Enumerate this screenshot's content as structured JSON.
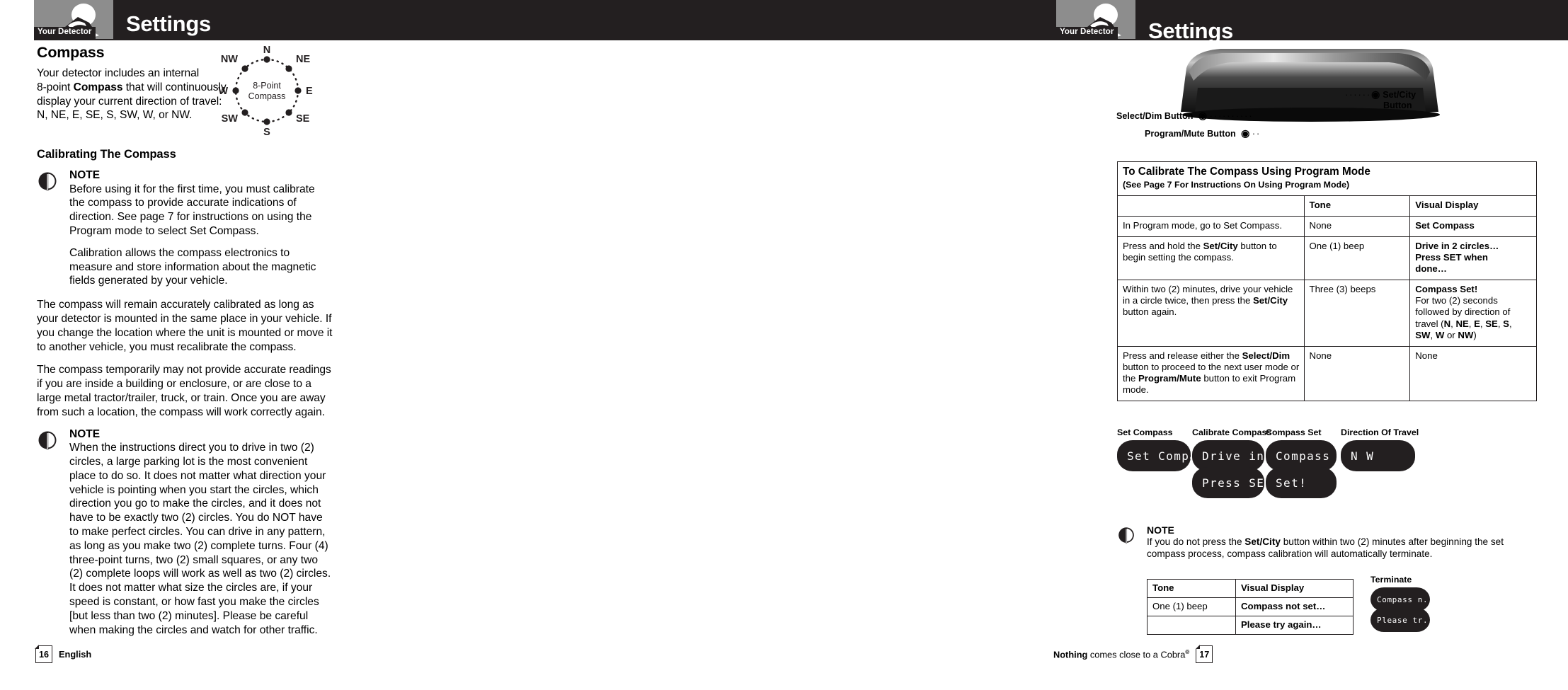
{
  "header": {
    "left": {
      "title": "Settings",
      "tag": "Your Detector"
    },
    "right": {
      "title": "Settings",
      "tag": "Your Detector"
    }
  },
  "left_page": {
    "section_title": "Compass",
    "intro": "Your detector includes an internal 8-point Compass that will continuously display your current direction of travel: N, NE, E, SE, S, SW, W, or NW.",
    "intro_bold_word": "Compass",
    "compass_diagram": {
      "center_line1": "8-Point",
      "center_line2": "Compass",
      "points": [
        "N",
        "NE",
        "E",
        "SE",
        "S",
        "SW",
        "W",
        "NW"
      ]
    },
    "subsection_title": "Calibrating The Compass",
    "note1": {
      "label": "NOTE",
      "p1": "Before using it for the first time, you must calibrate the compass to provide accurate indications of direction. See page 7 for instructions on using the Program mode to select Set Compass.",
      "p2": "Calibration allows the compass electronics to measure and store information about the magnetic fields generated by your vehicle."
    },
    "para1": "The compass will remain accurately calibrated as long as your detector is mounted in the same place in your vehicle. If you change the location where the unit is mounted or move it to another vehicle, you must recalibrate the compass.",
    "para2": "The compass temporarily may not provide accurate readings if you are inside a building or enclosure, or are close to a large metal tractor/trailer, truck, or train. Once you are away from such a location, the compass will work correctly again.",
    "note2": {
      "label": "NOTE",
      "p1": "When the instructions direct you to drive in two (2) circles, a large parking lot is the most convenient place to do so. It does not matter what direction your vehicle is pointing when you start the circles, which direction you go to make the circles, and it does not have to be exactly two (2) circles. You do NOT have to make perfect circles. You can drive in any pattern, as long as you make two (2) complete turns. Four (4) three-point turns, two (2) small squares, or any two (2) complete loops will work as well as two (2) circles. It does not matter what size the circles are, if your speed is constant, or how fast you make the circles [but less than two (2) minutes]. Please be careful when making the circles and watch for other traffic."
    },
    "footer": {
      "page": "16",
      "text": "English"
    }
  },
  "right_page": {
    "callouts": {
      "select_dim": "Select/Dim Button",
      "program_mute": "Program/Mute Button",
      "set_city_line1": "Set/City",
      "set_city_line2": "Button"
    },
    "table": {
      "title": "To Calibrate The Compass Using Program Mode",
      "subtitle": "(See Page 7 For Instructions On Using Program Mode)",
      "headers": [
        "",
        "Tone",
        "Visual Display"
      ],
      "rows": [
        {
          "step_html": "In Program mode, go to Set Compass.",
          "tone": "None",
          "visual_html": "<b>Set Compass</b>"
        },
        {
          "step_html": "Press and hold the <b>Set/City</b> button to begin setting the compass.",
          "tone": "One (1) beep",
          "visual_html": "<b>Drive in 2 circles…<br>Press SET when<br>done…</b>"
        },
        {
          "step_html": "Within two (2) minutes, drive your vehicle in a circle twice, then press the <b>Set/City</b> button again.",
          "tone": "Three (3) beeps",
          "visual_html": "<b>Compass Set!</b><br>For two (2) seconds followed by direction of travel (<b>N</b>, <b>NE</b>, <b>E</b>, <b>SE</b>, <b>S</b>, <b>SW</b>, <b>W</b> or <b>NW</b>)"
        },
        {
          "step_html": "Press and release either the <b>Select/Dim</b> button to proceed to the next user mode or the <b>Program/Mute</b> button to exit Program mode.",
          "tone": "None",
          "visual_html": "None"
        }
      ]
    },
    "lcd_displays": [
      {
        "label": "Set Compass",
        "screens": [
          "Set Compa..."
        ]
      },
      {
        "label": "Calibrate Compass",
        "screens": [
          "Drive in...",
          "Press SET..."
        ]
      },
      {
        "label": "Compass Set",
        "screens": [
          "Compass",
          "Set!"
        ]
      },
      {
        "label": "Direction Of Travel",
        "screens": [
          "N W        h"
        ]
      }
    ],
    "note": {
      "label": "NOTE",
      "text_html": "If you do not press the <b>Set/City</b> button within two (2) minutes after beginning the set compass process, compass calibration will automatically terminate."
    },
    "table2": {
      "headers": [
        "Tone",
        "Visual Display"
      ],
      "rows": [
        {
          "tone": "One (1) beep",
          "visual": "Compass not set…"
        },
        {
          "tone": "",
          "visual": "Please try again…"
        }
      ]
    },
    "terminate": {
      "label": "Terminate",
      "screens": [
        "Compass n...",
        "Please tr..."
      ]
    },
    "footer": {
      "page": "17",
      "bold": "Nothing",
      "rest": " comes close to a Cobra",
      "reg": "®"
    }
  },
  "colors": {
    "ink": "#231f20",
    "logo_gray": "#8d8d8d",
    "paper": "#ffffff"
  }
}
